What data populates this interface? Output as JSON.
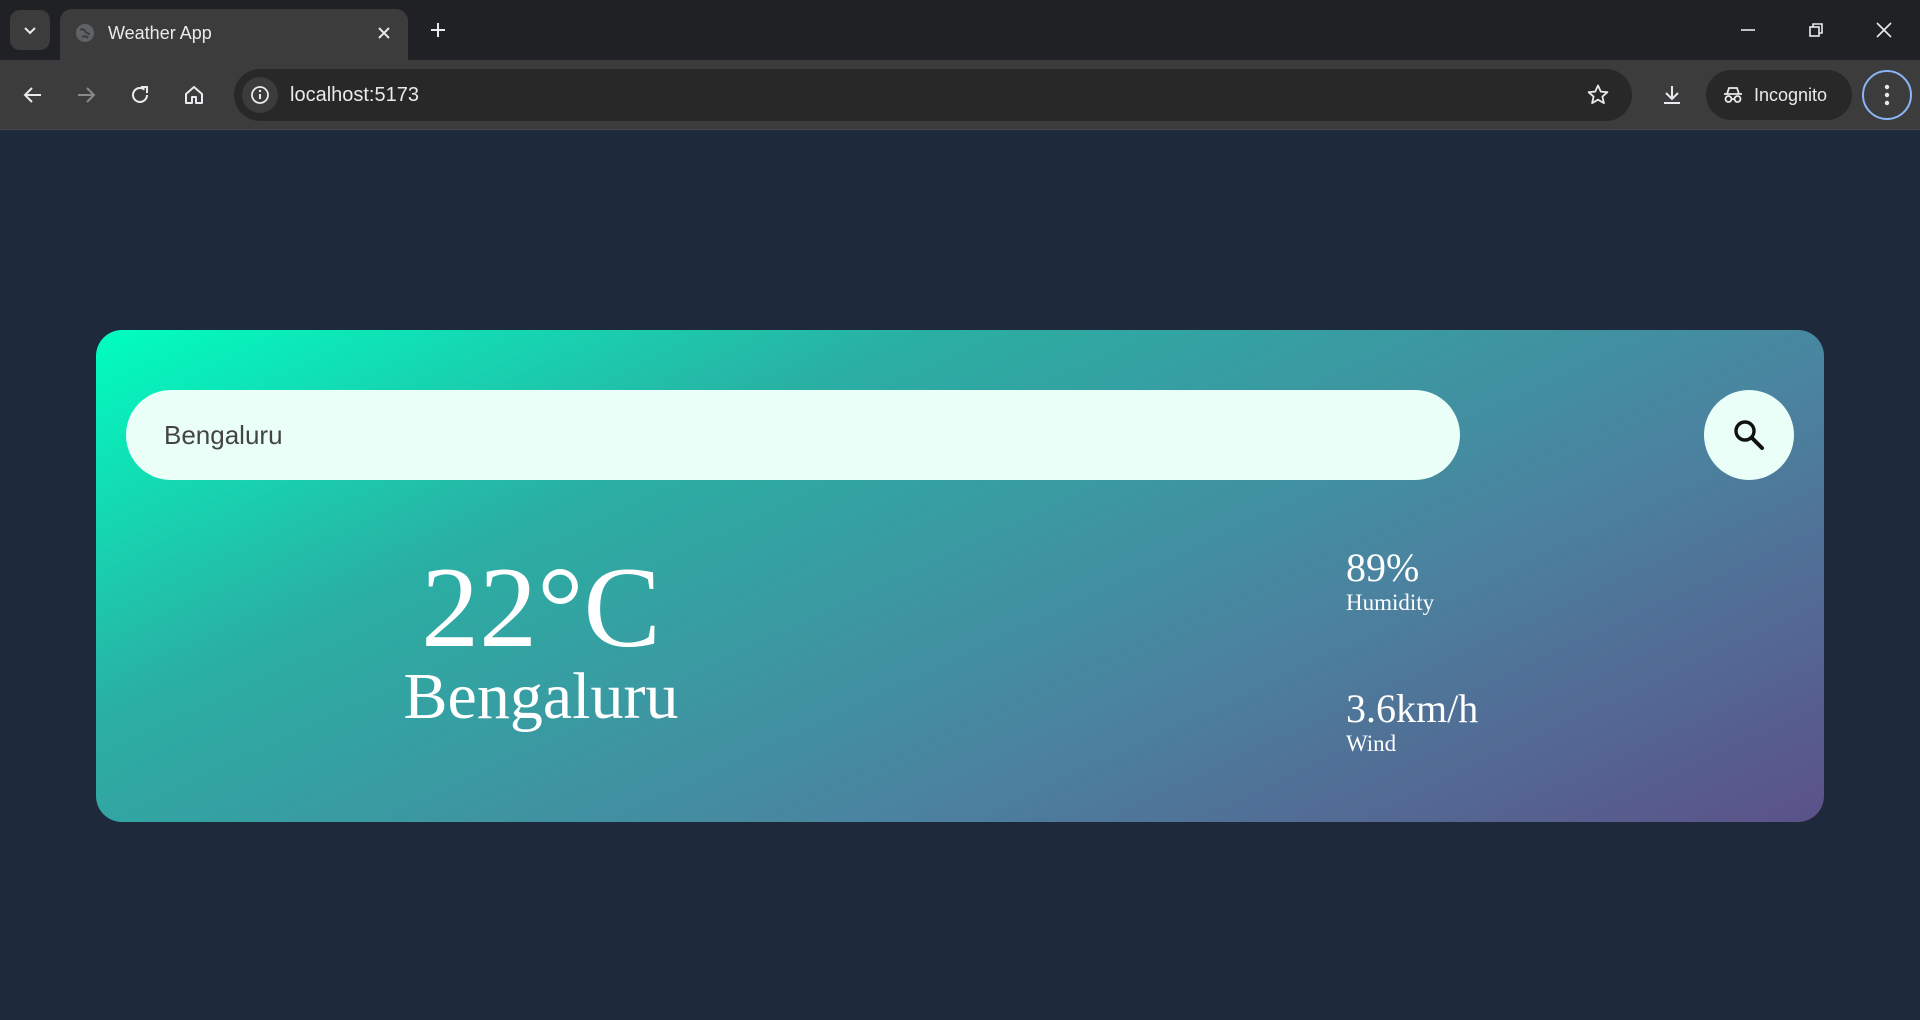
{
  "browser": {
    "tab_title": "Weather App",
    "url": "localhost:5173",
    "profile_label": "Incognito",
    "icons": {
      "tab_list": "chevron-down-icon",
      "favicon": "globe-icon",
      "tab_close": "close-icon",
      "new_tab": "plus-icon",
      "minimize": "minimize-icon",
      "restore": "restore-icon",
      "close_window": "close-icon",
      "back": "arrow-left-icon",
      "forward": "arrow-right-icon",
      "reload": "reload-icon",
      "home": "home-icon",
      "site_info": "info-icon",
      "bookmark": "star-icon",
      "download": "download-icon",
      "incognito": "incognito-icon",
      "menu": "kebab-menu-icon"
    }
  },
  "app": {
    "search": {
      "value": "Bengaluru",
      "button_icon": "search-icon"
    },
    "weather": {
      "temperature": "22°C",
      "city": "Bengaluru",
      "humidity_value": "89%",
      "humidity_label": "Humidity",
      "wind_value": "3.6km/h",
      "wind_label": "Wind"
    }
  },
  "colors": {
    "page_background": "#1e293b",
    "card_gradient_start": "#00ffc0",
    "card_gradient_end": "#5b5188",
    "input_background": "#ebfff9",
    "chrome_dark": "#202124",
    "chrome_toolbar": "#3c3c3c",
    "focus_ring": "#8ab4f8"
  }
}
